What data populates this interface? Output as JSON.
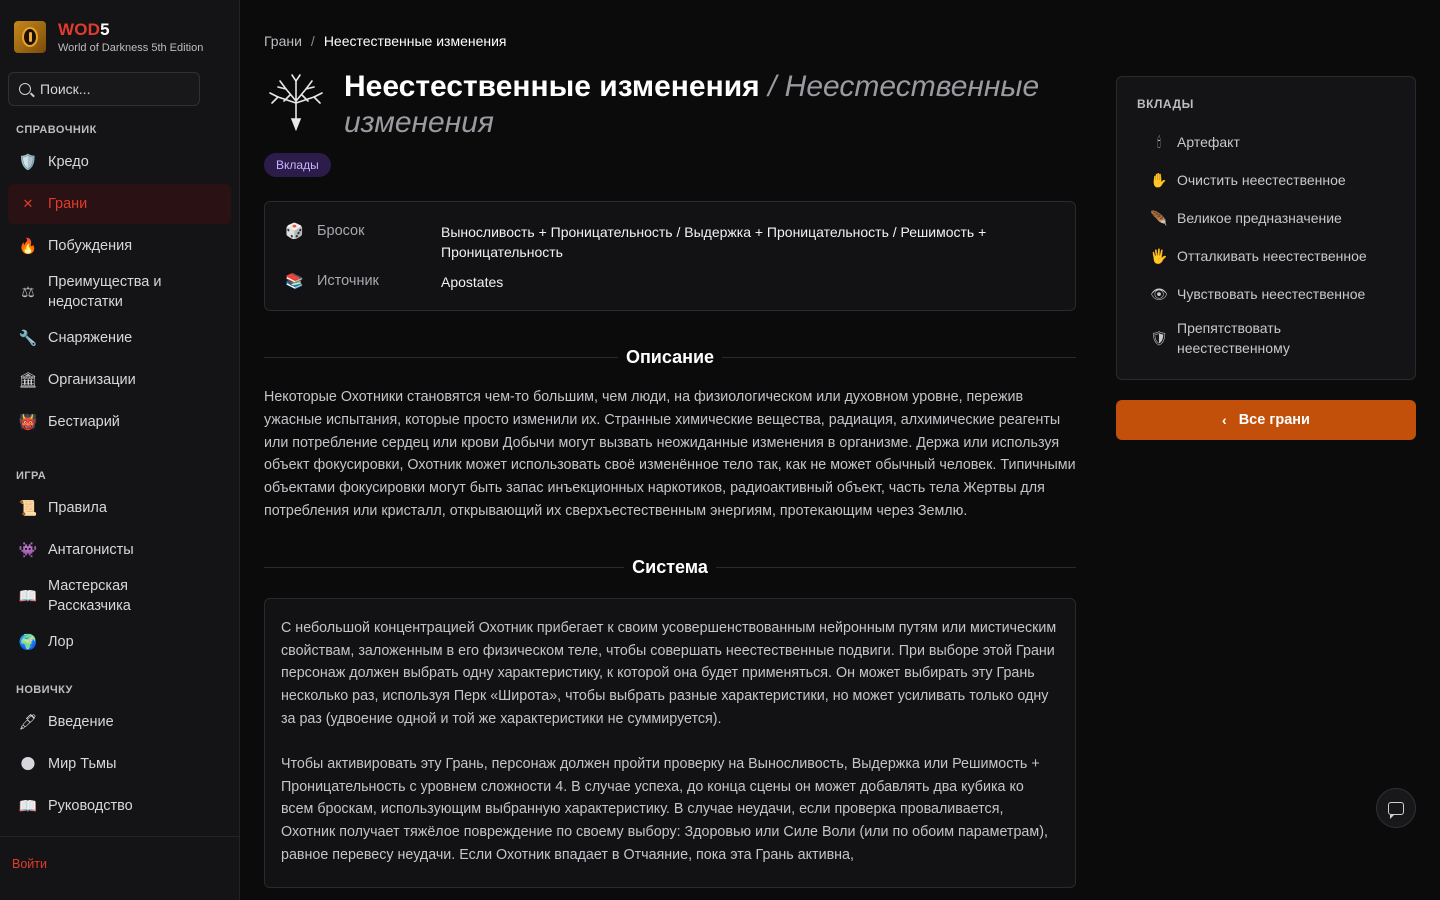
{
  "brand": {
    "title_red": "WOD",
    "title_white": "5",
    "subtitle": "World of Darkness 5th Edition"
  },
  "search": {
    "placeholder": "Поиск..."
  },
  "sidebar": {
    "sections": [
      {
        "title": "СПРАВОЧНИК",
        "items": [
          {
            "label": "Кредо",
            "icon": "shield-icon",
            "active": false
          },
          {
            "label": "Грани",
            "icon": "crossed-swords-icon",
            "active": true
          },
          {
            "label": "Побуждения",
            "icon": "fire-icon",
            "active": false
          },
          {
            "label": "Преимущества и недостатки",
            "icon": "scales-icon",
            "active": false
          },
          {
            "label": "Снаряжение",
            "icon": "wrench-icon",
            "active": false
          },
          {
            "label": "Организации",
            "icon": "building-icon",
            "active": false
          },
          {
            "label": "Бестиарий",
            "icon": "demon-icon",
            "active": false
          }
        ]
      },
      {
        "title": "ИГРА",
        "items": [
          {
            "label": "Правила",
            "icon": "scroll-icon"
          },
          {
            "label": "Антагонисты",
            "icon": "invader-icon"
          },
          {
            "label": "Мастерская Рассказчика",
            "icon": "book-icon"
          },
          {
            "label": "Лор",
            "icon": "globe-icon"
          }
        ]
      },
      {
        "title": "НОВИЧКУ",
        "items": [
          {
            "label": "Введение",
            "icon": "quill-icon"
          },
          {
            "label": "Мир Тьмы",
            "icon": "moon-icon"
          },
          {
            "label": "Руководство",
            "icon": "book-icon"
          }
        ]
      }
    ],
    "login": "Войти"
  },
  "breadcrumb": {
    "parent": "Грани",
    "separator": "/",
    "current": "Неестественные изменения"
  },
  "page": {
    "title": "Неестественные изменения",
    "title_alt": "/ Неестественные изменения",
    "badge": "Вклады"
  },
  "info": {
    "roll_label": "Бросок",
    "roll_value": "Выносливость + Проницательность / Выдержка + Проницательность / Решимость + Проницательность",
    "source_label": "Источник",
    "source_value": "Apostates"
  },
  "description": {
    "heading": "Описание",
    "text": "Некоторые Охотники становятся чем-то большим, чем люди, на физиологическом или духовном уровне, пережив ужасные испытания, которые просто изменили их. Странные химические вещества, радиация, алхимические реагенты или потребление сердец или крови Добычи могут вызвать неожиданные изменения в организме. Держа или используя объект фокусировки, Охотник может использовать своё изменённое тело так, как не может обычный человек. Типичными объектами фокусировки могут быть запас инъекционных наркотиков, радиоактивный объект, часть тела Жертвы для потребления или кристалл, открывающий их сверхъестественным энергиям, протекающим через Землю."
  },
  "system": {
    "heading": "Система",
    "p1": "С небольшой концентрацией Охотник прибегает к своим усовершенствованным нейронным путям или мистическим свойствам, заложенным в его физическом теле, чтобы совершать неестественные подвиги. При выборе этой Грани персонаж должен выбрать одну характеристику, к которой она будет применяться. Он может выбирать эту Грань несколько раз, используя Перк «Широта», чтобы выбрать разные характеристики, но может усиливать только одну за раз (удвоение одной и той же характеристики не суммируется).",
    "p2": "Чтобы активировать эту Грань, персонаж должен пройти проверку на Выносливость, Выдержка или Решимость + Проницательность с уровнем сложности 4. В случае успеха, до конца сцены он может добавлять два кубика ко всем броскам, использующим выбранную характеристику. В случае неудачи, если проверка проваливается, Охотник получает тяжёлое повреждение по своему выбору: Здоровью или Силе Воли (или по обоим параметрам), равное перевесу неудачи. Если Охотник впадает в Отчаяние, пока эта Грань активна,"
  },
  "tabs_panel": {
    "title": "ВКЛАДЫ",
    "items": [
      {
        "label": "Артефакт",
        "icon": "chalice-icon"
      },
      {
        "label": "Очистить неестественное",
        "icon": "hand-flame-icon"
      },
      {
        "label": "Великое предназначение",
        "icon": "feather-icon"
      },
      {
        "label": "Отталкивать неестественное",
        "icon": "open-hand-icon"
      },
      {
        "label": "Чувствовать неестественное",
        "icon": "eye-hand-icon"
      },
      {
        "label": "Препятствовать неестественному",
        "icon": "shield-icon"
      }
    ]
  },
  "all_button": {
    "label": "Все грани"
  },
  "colors": {
    "accent_red": "#e23a2c",
    "button_orange": "#c2500a",
    "badge_bg": "#2b1c4a"
  }
}
